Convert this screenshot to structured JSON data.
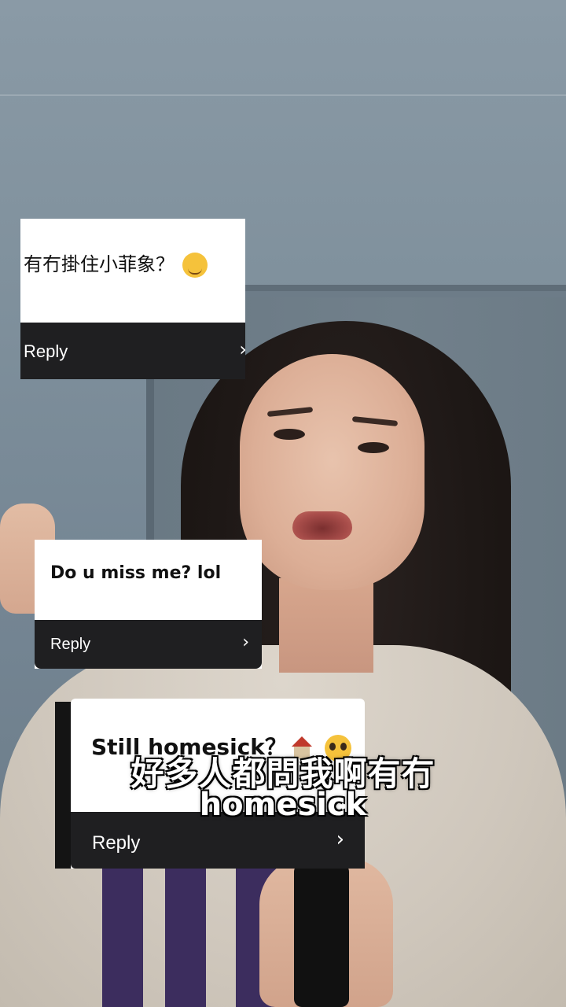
{
  "cards": [
    {
      "question": "有冇掛住小菲象？",
      "emoji": "winking-face",
      "reply_label": "Reply",
      "chevron": "›"
    },
    {
      "question": "Do u miss me? lol",
      "reply_label": "Reply",
      "chevron": "›"
    },
    {
      "question": "Still homesick？",
      "emojis": [
        "house",
        "pleading-face"
      ],
      "reply_label": "Reply",
      "chevron": "›"
    }
  ],
  "subtitle": {
    "line1": "好多人都問我啊有冇",
    "line2": "homesick"
  },
  "colors": {
    "card_bg": "#ffffff",
    "reply_bar": "#1f1f21",
    "text": "#111111",
    "subtitle": "#ffffff",
    "sweater_stripe": "#3c2d5e"
  }
}
